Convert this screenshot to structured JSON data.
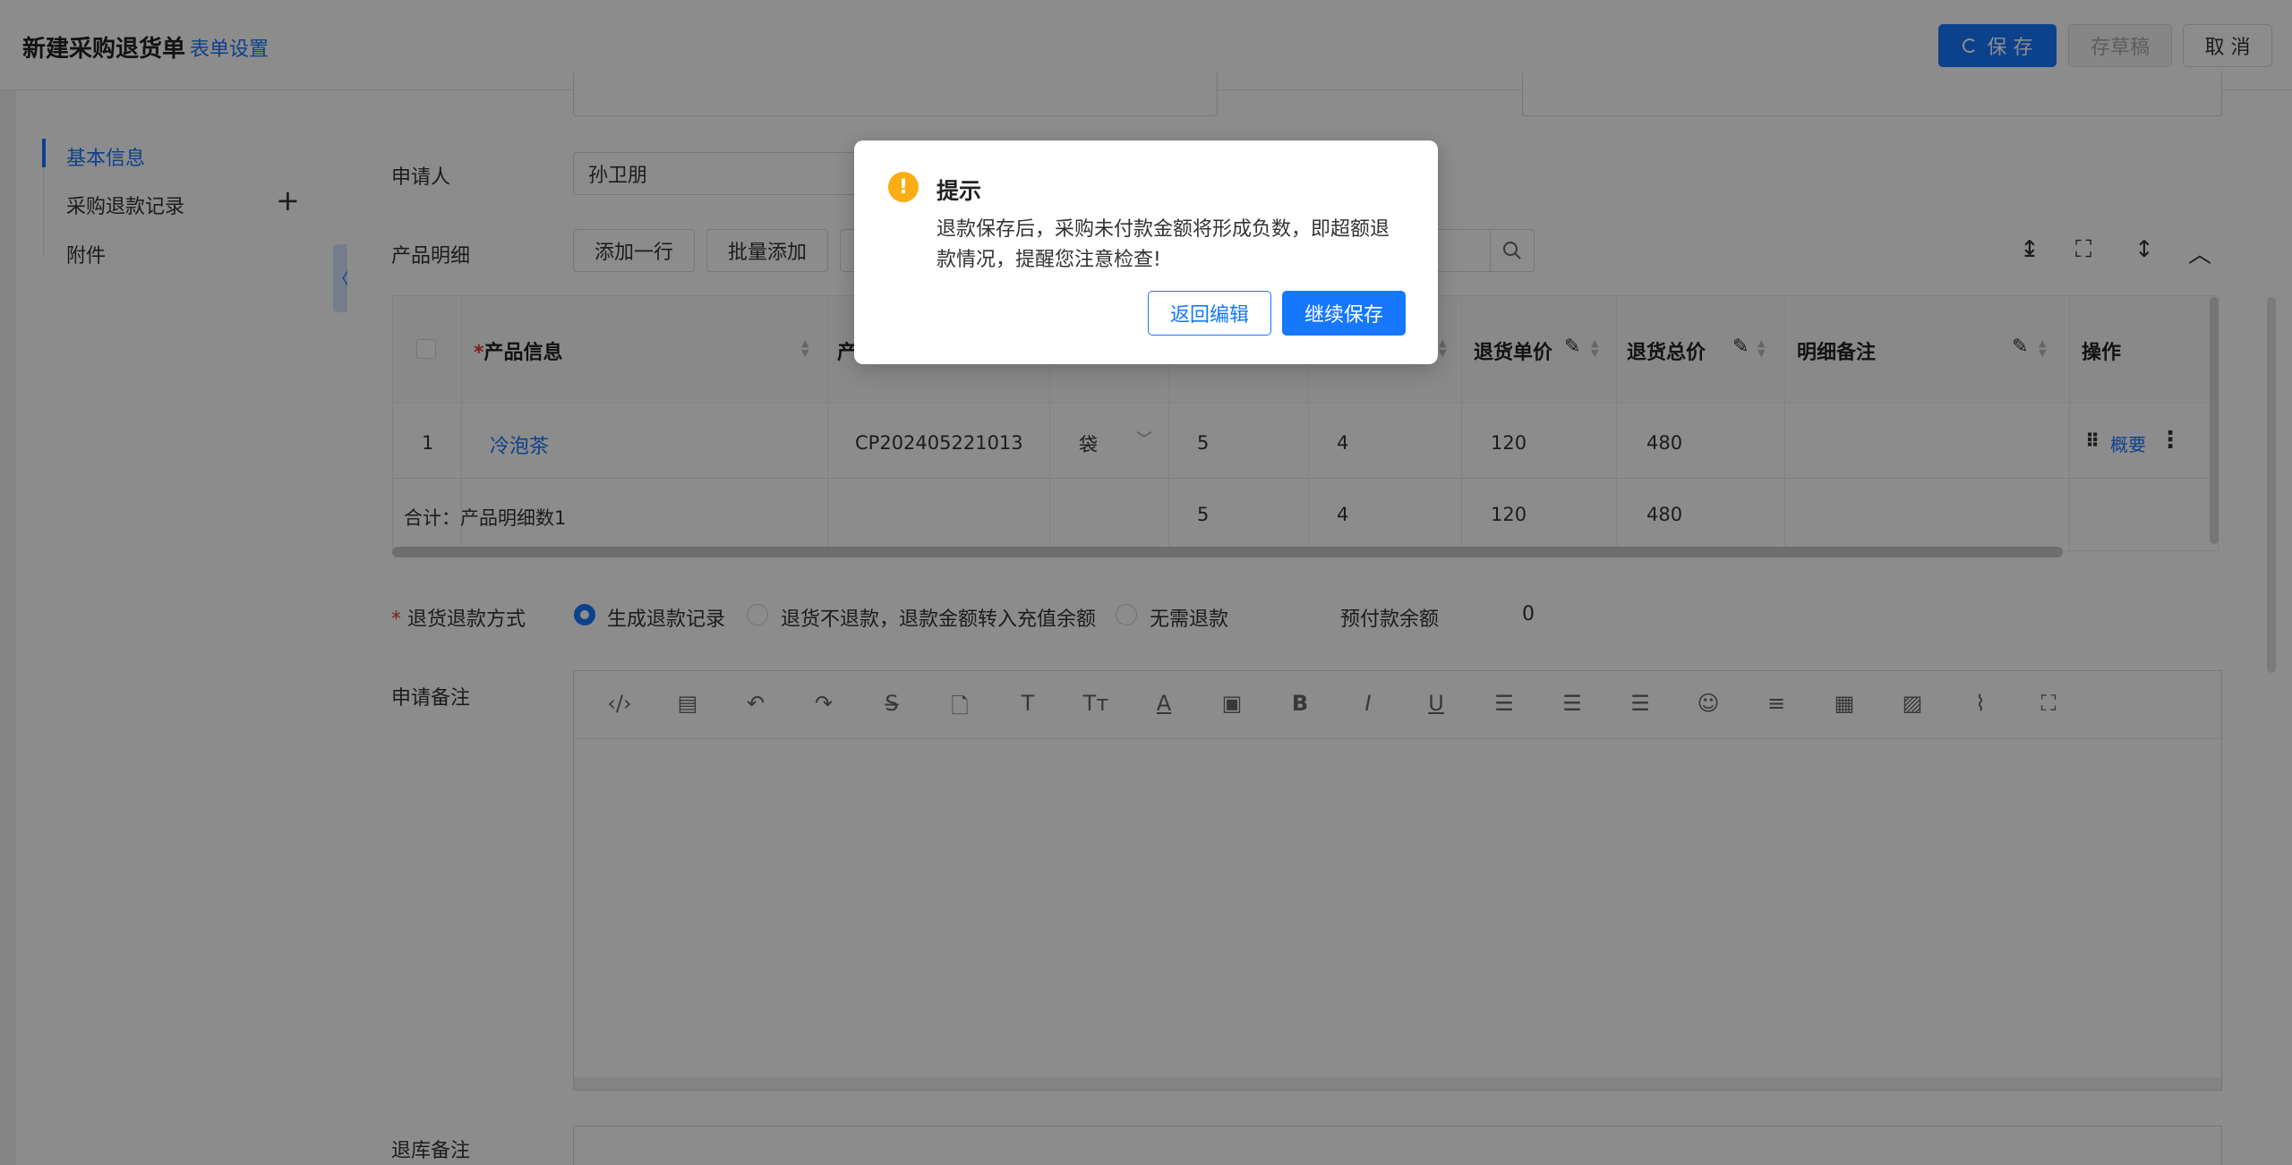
{
  "header": {
    "title": "新建采购退货单",
    "form_settings": "表单设置",
    "save": "保 存",
    "draft": "存草稿",
    "cancel": "取 消"
  },
  "sidebar": {
    "items": [
      {
        "label": "基本信息"
      },
      {
        "label": "采购退款记录"
      },
      {
        "label": "附件"
      }
    ],
    "collapse_icon": "chevron-left-icon"
  },
  "form": {
    "applicant_label": "申请人",
    "applicant_value": "孙卫朋",
    "product_detail_label": "产品明细",
    "add_row": "添加一行",
    "batch_add": "批量添加"
  },
  "table": {
    "columns": [
      "产品信息",
      "产",
      "退货单价",
      "退货总价",
      "明细备注",
      "操作"
    ],
    "required_mark": "*",
    "rows": [
      {
        "index": "1",
        "name": "冷泡茶",
        "code": "CP202405221013",
        "unit": "袋",
        "qty1": "5",
        "qty2": "4",
        "price": "120",
        "total": "480",
        "note": "",
        "action": "概要"
      }
    ],
    "summary": {
      "label": "合计：产品明细数1",
      "qty1": "5",
      "qty2": "4",
      "price": "120",
      "total": "480"
    }
  },
  "refund": {
    "label": "退货退款方式",
    "options": [
      "生成退款记录",
      "退货不退款，退款金额转入充值余额",
      "无需退款"
    ],
    "selected": "生成退款记录",
    "prepay_label": "预付款余额",
    "prepay_value": "0"
  },
  "remarks": {
    "apply_label": "申请备注",
    "warehouse_label": "退库备注"
  },
  "dialog": {
    "title": "提示",
    "message": "退款保存后，采购未付款金额将形成负数，即超额退款情况，提醒您注意检查!",
    "back": "返回编辑",
    "continue": "继续保存"
  },
  "colors": {
    "primary": "#1677ff",
    "warning": "#faad14",
    "required": "#e8383d"
  }
}
